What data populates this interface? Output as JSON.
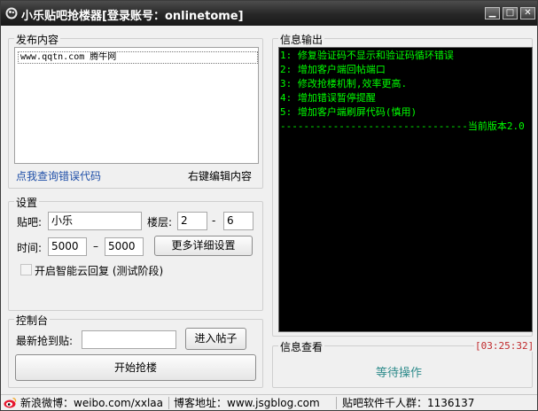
{
  "window": {
    "title": "小乐贴吧抢楼器[登录账号：onlinetome]",
    "min_label": "▁",
    "max_label": "□",
    "close_label": "✕"
  },
  "publish": {
    "group_title": "发布内容",
    "content_line": "www.qqtn.com   腾牛网",
    "lookup_link": "点我查询错误代码",
    "right_click_tip": "右键编辑内容"
  },
  "settings": {
    "group_title": "设置",
    "forum_label": "贴吧:",
    "forum_value": "小乐",
    "floor_label": "楼层:",
    "floor_from": "2",
    "floor_dash": "-",
    "floor_to": "6",
    "time_label": "时间:",
    "time_from": "5000",
    "time_dash": "–",
    "time_to": "5000",
    "more_settings_button": "更多详细设置",
    "smart_reply_label": "开启智能云回复 (测试阶段)"
  },
  "control": {
    "group_title": "控制台",
    "latest_label": "最新抢到贴:",
    "latest_value": "",
    "enter_post_button": "进入帖子",
    "start_button": "开始抢楼"
  },
  "info_output": {
    "group_title": "信息输出",
    "lines": [
      {
        "text": "1: 修复验证码不显示和验证码循环错误",
        "color": "#00ff00"
      },
      {
        "text": "2: 增加客户端回帖端口",
        "color": "#00ff00"
      },
      {
        "text": "3: 修改抢楼机制,效率更高.",
        "color": "#00ff00"
      },
      {
        "text": "4: 增加错误暂停提醒",
        "color": "#00ff00"
      },
      {
        "text": "5: 增加客户端刷屏代码(慎用)",
        "color": "#00ff00"
      },
      {
        "text": "--------------------------------当前版本2.0",
        "color": "#00ff00"
      }
    ]
  },
  "info_view": {
    "group_title": "信息查看",
    "time": "[03:25:32]",
    "status": "等待操作"
  },
  "statusbar": {
    "weibo": "新浪微博：weibo.com/xxlaa",
    "blog": "博客地址：www.jsgblog.com",
    "group": "贴吧软件千人群：1136137"
  },
  "colors": {
    "link": "#1f4fa8",
    "console_text": "#00ff00",
    "time_red": "#c0282b",
    "status_teal": "#2e8b8b"
  }
}
